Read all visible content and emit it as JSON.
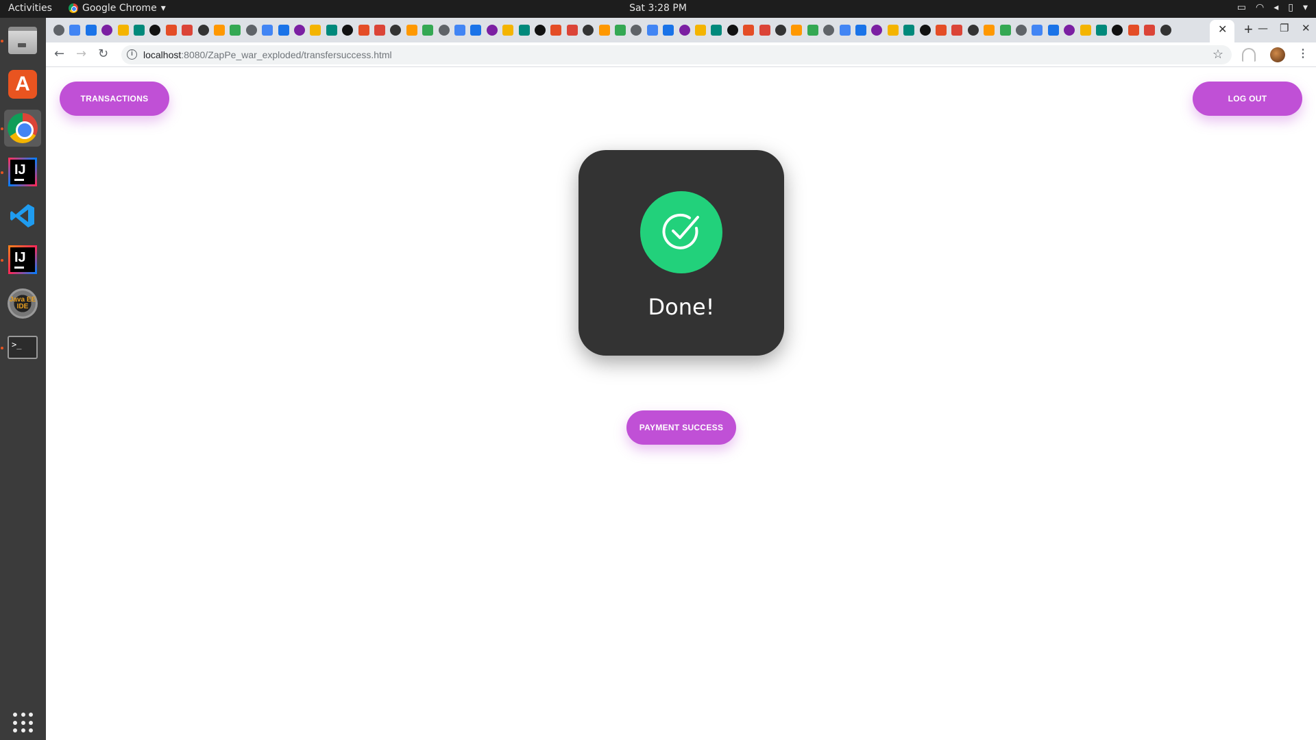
{
  "os": {
    "activities_label": "Activities",
    "app_menu_label": "Google Chrome",
    "clock": "Sat  3:28 PM"
  },
  "dock": {
    "apps": [
      "Files",
      "Ubuntu Software",
      "Google Chrome",
      "IntelliJ IDEA Community",
      "Visual Studio Code",
      "IntelliJ IDEA Ultimate",
      "Java EE IDE",
      "Terminal"
    ],
    "javaee_label": "Java EE IDE",
    "terminal_prompt": ">_"
  },
  "browser": {
    "url_host": "localhost",
    "url_path": ":8080/ZapPe_war_exploded/transfersuccess.html"
  },
  "page": {
    "transactions_label": "TRANSACTIONS",
    "logout_label": "LOG OUT",
    "done_text": "Done!",
    "payment_label": "PAYMENT SUCCESS"
  },
  "colors": {
    "accent": "#c050d6",
    "success": "#22d17b",
    "card_bg": "#333333"
  }
}
